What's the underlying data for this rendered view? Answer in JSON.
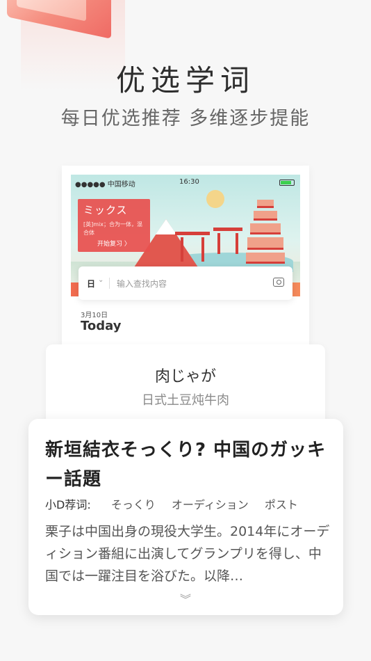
{
  "hero": {
    "title": "优选学词",
    "subtitle": "每日优选推荐  多维逐步提能"
  },
  "phone": {
    "status_bar": {
      "carrier": "●●●●● 中国移动",
      "time": "16:30"
    },
    "review_card": {
      "word": "ミックス",
      "definition": "[英]mix；合为一体，混合体",
      "review_label": "开始复习 〉"
    },
    "search": {
      "language": "日",
      "placeholder": "输入查找内容"
    },
    "date": "3月10日",
    "today": "Today"
  },
  "word_card": {
    "word": "肉じゃが",
    "meaning": "日式土豆炖牛肉"
  },
  "article": {
    "title": "新垣結衣そっくり? 中国のガッキー話題",
    "keywords_label": "小D荐词:",
    "keywords": [
      "そっくり",
      "オーディション",
      "ポスト"
    ],
    "body": "栗子は中国出身の現役大学生。2014年にオーディション番組に出演してグランプリを得し、中国では一躍注目を浴びた。以降…"
  },
  "colors": {
    "accent_red": "#e84f4d",
    "background": "#f7f7f7"
  }
}
